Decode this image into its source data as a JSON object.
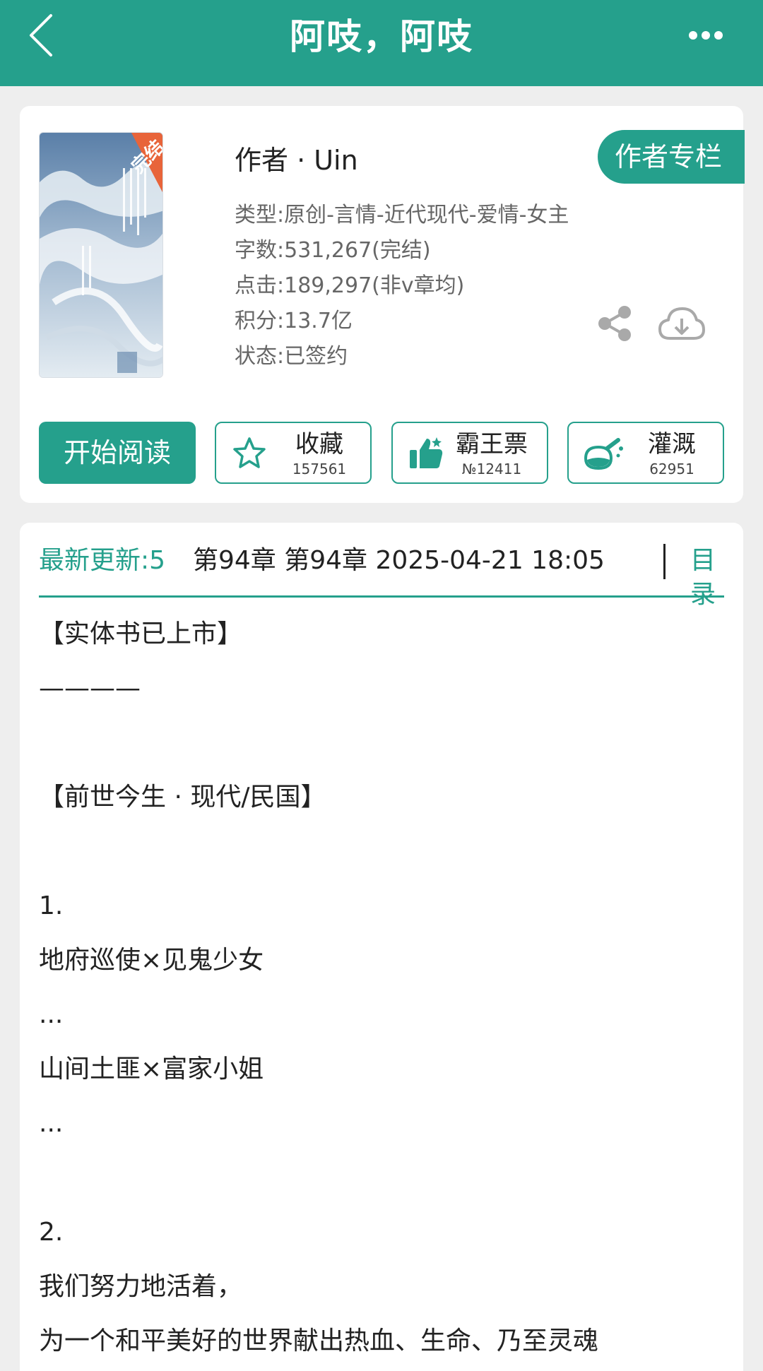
{
  "header": {
    "title": "阿吱，阿吱",
    "back_icon": "chevron-left-icon",
    "more_icon": "more-dots-icon"
  },
  "book": {
    "cover_icon": "book-cover-image",
    "cover_badge": "完结",
    "author_line": "作者 · Uin",
    "author_column_label": "作者专栏",
    "meta": [
      "类型:原创-言情-近代现代-爱情-女主",
      "字数:531,267(完结)",
      "点击:189,297(非v章均)",
      "积分:13.7亿",
      "状态:已签约"
    ],
    "share_icon": "share-icon",
    "download_icon": "cloud-download-icon"
  },
  "actions": {
    "start_reading": "开始阅读",
    "favorite": {
      "label": "收藏",
      "count": "157561",
      "icon": "star-icon"
    },
    "bawangpiao": {
      "label": "霸王票",
      "count": "№12411",
      "icon": "thumbs-up-icon"
    },
    "irrigate": {
      "label": "灌溉",
      "count": "62951",
      "icon": "flask-icon"
    }
  },
  "latest": {
    "label": "最新更新:5",
    "text": "第94章 第94章 2025-04-21 18:05",
    "toc_label": "目录"
  },
  "intro_lines": [
    "【实体书已上市】",
    "————",
    "",
    "【前世今生 · 现代/民国】",
    "",
    "1.",
    "地府巡使×见鬼少女",
    "...",
    "山间土匪×富家小姐",
    "...",
    "",
    "2.",
    "我们努力地活着，",
    "为一个和平美好的世界献出热血、生命、乃至灵魂"
  ],
  "colors": {
    "brand": "#25a08c",
    "background": "#eeeeee",
    "card": "#ffffff"
  }
}
